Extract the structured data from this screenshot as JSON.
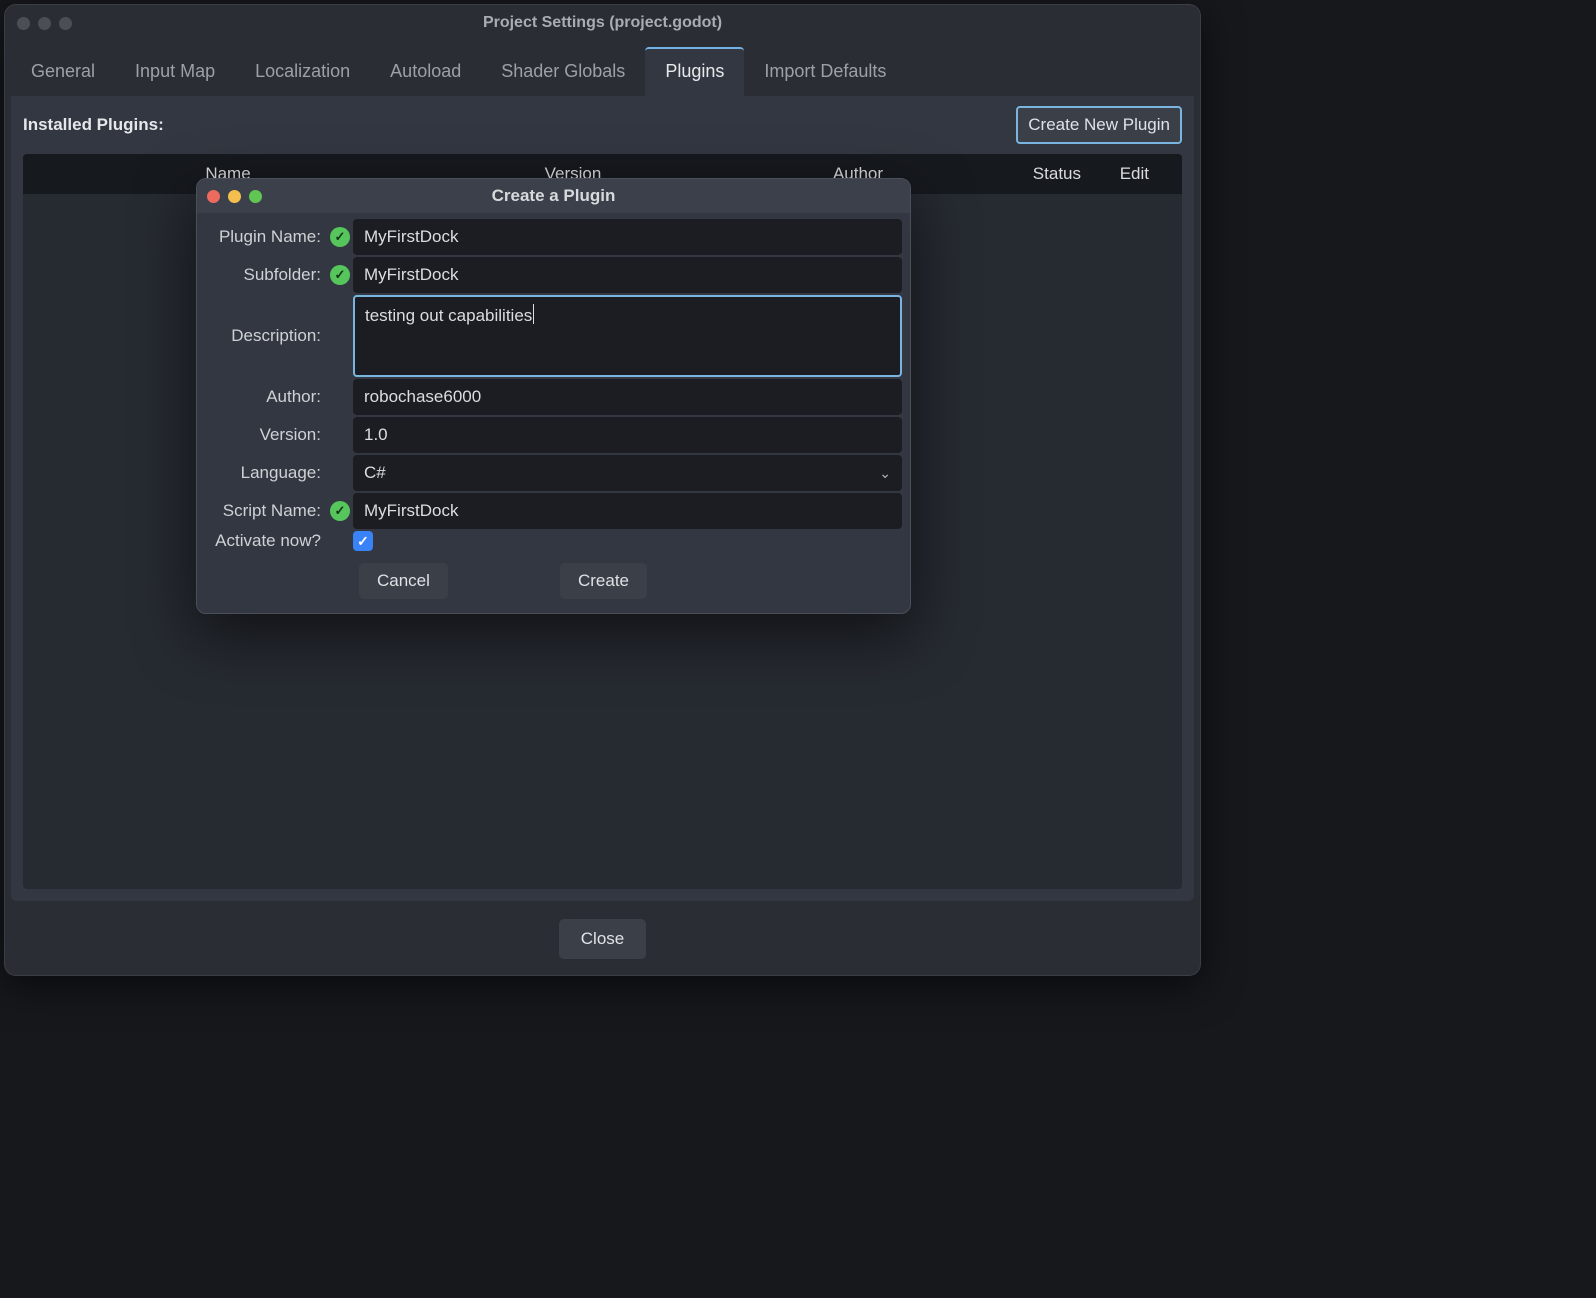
{
  "window": {
    "title": "Project Settings (project.godot)"
  },
  "tabs": {
    "general": "General",
    "input_map": "Input Map",
    "localization": "Localization",
    "autoload": "Autoload",
    "shader_globals": "Shader Globals",
    "plugins": "Plugins",
    "import_defaults": "Import Defaults"
  },
  "plugins_panel": {
    "installed_label": "Installed Plugins:",
    "create_btn": "Create New Plugin",
    "columns": {
      "name": "Name",
      "version": "Version",
      "author": "Author",
      "status": "Status",
      "edit": "Edit"
    }
  },
  "footer": {
    "close": "Close"
  },
  "modal": {
    "title": "Create a Plugin",
    "labels": {
      "plugin_name": "Plugin Name:",
      "subfolder": "Subfolder:",
      "description": "Description:",
      "author": "Author:",
      "version": "Version:",
      "language": "Language:",
      "script_name": "Script Name:",
      "activate_now": "Activate now?"
    },
    "values": {
      "plugin_name": "MyFirstDock",
      "subfolder": "MyFirstDock",
      "description": "testing out capabilities",
      "author": "robochase6000",
      "version": "1.0",
      "language": "C#",
      "script_name": "MyFirstDock",
      "activate_now": true
    },
    "buttons": {
      "cancel": "Cancel",
      "create": "Create"
    }
  }
}
